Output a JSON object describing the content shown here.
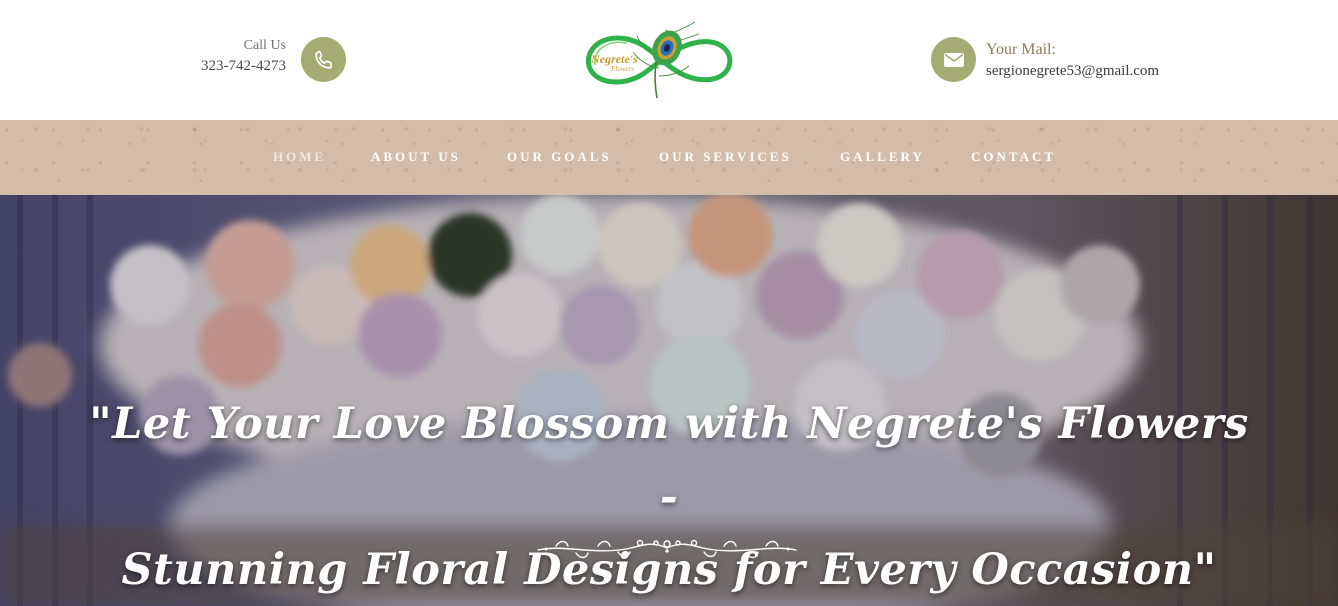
{
  "header": {
    "call_label": "Call Us",
    "phone_number": "323-742-4273",
    "mail_label": "Your Mail:",
    "email": "sergionegrete53@gmail.com",
    "logo_text_line1": "Negrete's",
    "logo_text_line2": "Flowers"
  },
  "nav": {
    "items": [
      {
        "label": "HOME"
      },
      {
        "label": "ABOUT US"
      },
      {
        "label": "OUR GOALS"
      },
      {
        "label": "OUR SERVICES"
      },
      {
        "label": "GALLERY"
      },
      {
        "label": "CONTACT"
      }
    ]
  },
  "hero": {
    "title_line1": "\"Let Your Love Blossom with Negrete's Flowers -",
    "title_line2": "Stunning Floral Designs for Every Occasion\""
  },
  "colors": {
    "accent_olive": "#a4ac74",
    "nav_background": "#d3bcaa",
    "logo_green": "#2fb24a"
  },
  "icons": {
    "phone": "phone-icon",
    "mail": "envelope-icon",
    "logo": "peacock-feather-infinity-logo",
    "divider": "floral-vine-divider"
  }
}
